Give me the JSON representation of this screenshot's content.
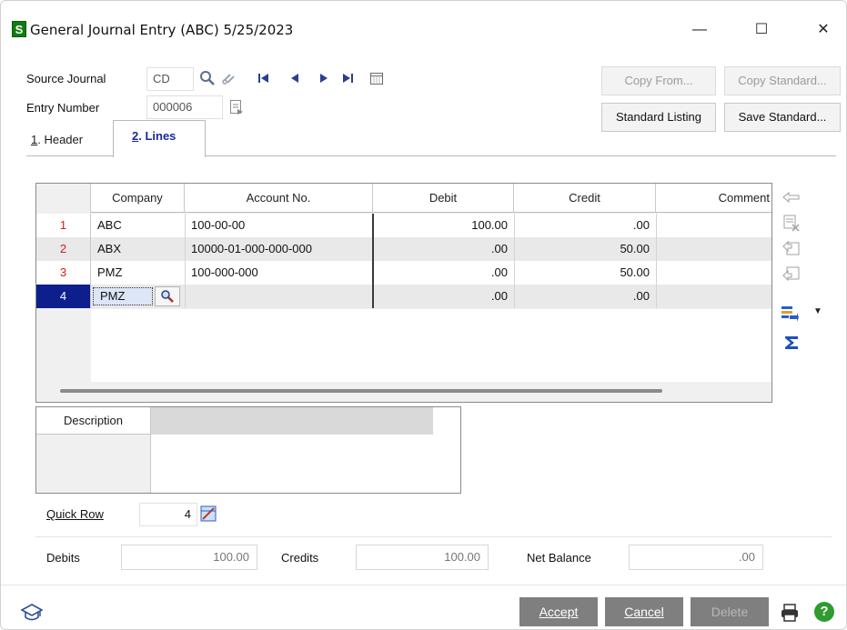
{
  "window": {
    "title": "General Journal Entry (ABC) 5/25/2023",
    "app_icon_letter": "S",
    "minimize": "—",
    "maximize": "☐",
    "close": "✕"
  },
  "header": {
    "source_journal_label": "Source Journal",
    "source_journal_value": "CD",
    "entry_number_label": "Entry Number",
    "entry_number_value": "000006",
    "copy_from_label": "Copy From...",
    "copy_standard_label": "Copy Standard...",
    "standard_listing_label": "Standard Listing",
    "save_standard_label": "Save Standard..."
  },
  "tabs": [
    {
      "num": "1",
      "label": ". Header"
    },
    {
      "num": "2",
      "label": ". Lines"
    }
  ],
  "grid": {
    "columns": [
      "Company",
      "Account No.",
      "Debit",
      "Credit",
      "Comment"
    ],
    "rows": [
      {
        "num": "1",
        "company": "ABC",
        "account": "100-00-00",
        "debit": "100.00",
        "credit": ".00"
      },
      {
        "num": "2",
        "company": "ABX",
        "account": "10000-01-000-000-000",
        "debit": ".00",
        "credit": "50.00"
      },
      {
        "num": "3",
        "company": "PMZ",
        "account": "100-000-000",
        "debit": ".00",
        "credit": "50.00"
      },
      {
        "num": "4",
        "company": "PMZ",
        "account": "",
        "debit": ".00",
        "credit": ".00"
      }
    ]
  },
  "description": {
    "label": "Description"
  },
  "quick_row": {
    "label": "Quick Row",
    "value": "4"
  },
  "totals": {
    "debits_label": "Debits",
    "debits_value": "100.00",
    "credits_label": "Credits",
    "credits_value": "100.00",
    "net_label": "Net Balance",
    "net_value": ".00"
  },
  "footer": {
    "accept": "Accept",
    "cancel": "Cancel",
    "delete": "Delete"
  },
  "colors": {
    "selected_row": "#0c1f8c",
    "row_number": "#d61c1c",
    "button_gray": "#7f7f7f",
    "help_green": "#2e9c2e"
  }
}
